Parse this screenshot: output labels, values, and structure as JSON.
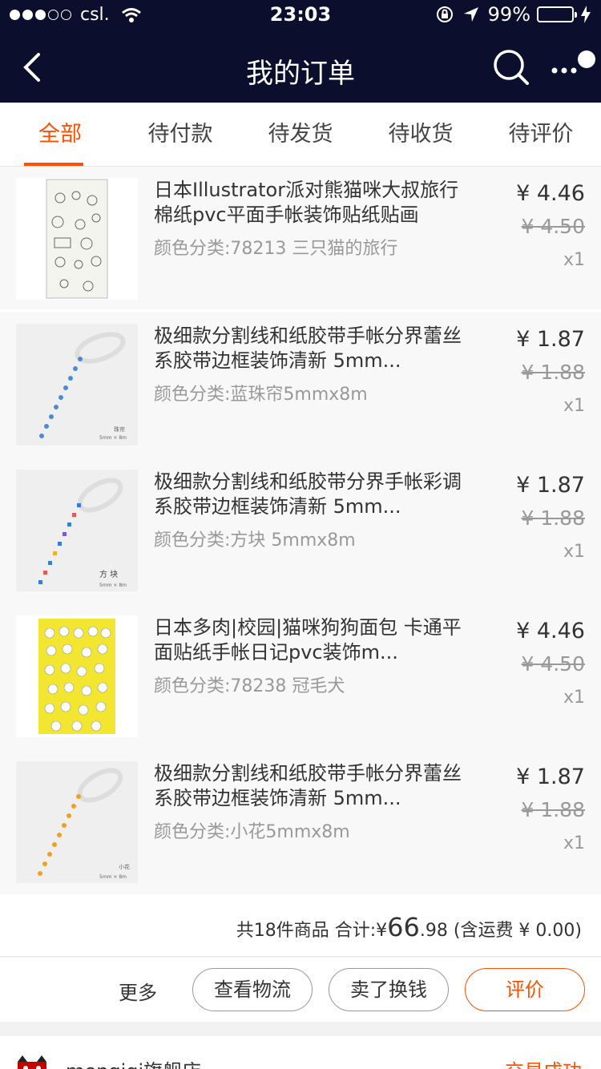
{
  "status_bar": {
    "carrier": "csl.",
    "time": "23:03",
    "battery": "99%",
    "battery_level": 0.99
  },
  "nav": {
    "title": "我的订单",
    "back_icon": "chevron-left-icon",
    "search_icon": "search-icon",
    "more_icon": "more-icon"
  },
  "tabs": [
    {
      "label": "全部",
      "active": true
    },
    {
      "label": "待付款"
    },
    {
      "label": "待发货"
    },
    {
      "label": "待收货"
    },
    {
      "label": "待评价"
    }
  ],
  "items": [
    {
      "name": "日本Illustrator派对熊猫咪大叔旅行棉纸pvc平面手帐装饰贴纸贴画",
      "spec": "颜色分类:78213 三只猫的旅行",
      "price": "¥ 4.46",
      "old_price": "¥ 4.50",
      "qty": "x1"
    },
    {
      "name": "极细款分割线和纸胶带手帐分界蕾丝系胶带边框装饰清新 5mm...",
      "spec": "颜色分类:蓝珠帘5mmx8m",
      "price": "¥ 1.87",
      "old_price": "¥ 1.88",
      "qty": "x1",
      "thumb_label": "珠帘"
    },
    {
      "name": "极细款分割线和纸胶带分界手帐彩调系胶带边框装饰清新 5mm...",
      "spec": "颜色分类:方块 5mmx8m",
      "price": "¥ 1.87",
      "old_price": "¥ 1.88",
      "qty": "x1",
      "thumb_label": "方 块"
    },
    {
      "name": "日本多肉|校园|猫咪狗狗面包 卡通平面贴纸手帐日记pvc装饰m...",
      "spec": "颜色分类:78238 冠毛犬",
      "price": "¥ 4.46",
      "old_price": "¥ 4.50",
      "qty": "x1"
    },
    {
      "name": "极细款分割线和纸胶带手帐分界蕾丝系胶带边框装饰清新 5mm...",
      "spec": "颜色分类:小花5mmx8m",
      "price": "¥ 1.87",
      "old_price": "¥ 1.88",
      "qty": "x1",
      "thumb_label": "小花"
    }
  ],
  "summary": {
    "count": "共18件商品",
    "total_prefix": "合计:¥",
    "total_int": "66",
    "total_dec": ".98",
    "shipping": "(含运费 ¥ 0.00)"
  },
  "actions": {
    "more": "更多",
    "logistics": "查看物流",
    "resell": "卖了换钱",
    "review": "评价"
  },
  "next_order": {
    "store": "mengiqi旗舰店",
    "status": "交易成功"
  },
  "colors": {
    "accent": "#ff5000",
    "navbar": "#0b0f2d"
  }
}
